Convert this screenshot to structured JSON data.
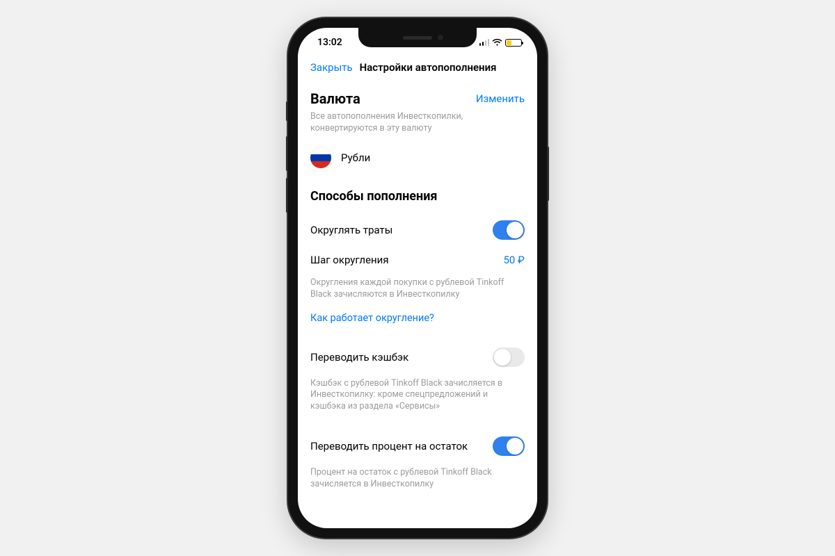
{
  "status": {
    "time": "13:02"
  },
  "nav": {
    "close": "Закрыть",
    "title": "Настройки автопополнения"
  },
  "currency": {
    "title": "Валюта",
    "edit": "Изменить",
    "description": "Все автопополнения Инвесткопилки, конвертируются в эту валюту",
    "name": "Рубли"
  },
  "methods": {
    "title": "Способы пополнения",
    "rounding": {
      "label": "Округлять траты",
      "step_label": "Шаг округления",
      "step_value": "50 ₽",
      "description": "Округления каждой покупки с рублевой Tinkoff Black зачисляются в Инвесткопилку",
      "help_link": "Как работает округление?"
    },
    "cashback": {
      "label": "Переводить кэшбэк",
      "description": "Кэшбэк с рублевой Tinkoff Black зачисляется в Инвесткопилку: кроме спецпредложений и кэшбэка из раздела «Сервисы»"
    },
    "interest": {
      "label": "Переводить процент на остаток",
      "description": "Процент на остаток с рублевой Tinkoff Black зачисляется в Инвесткопилку"
    }
  }
}
